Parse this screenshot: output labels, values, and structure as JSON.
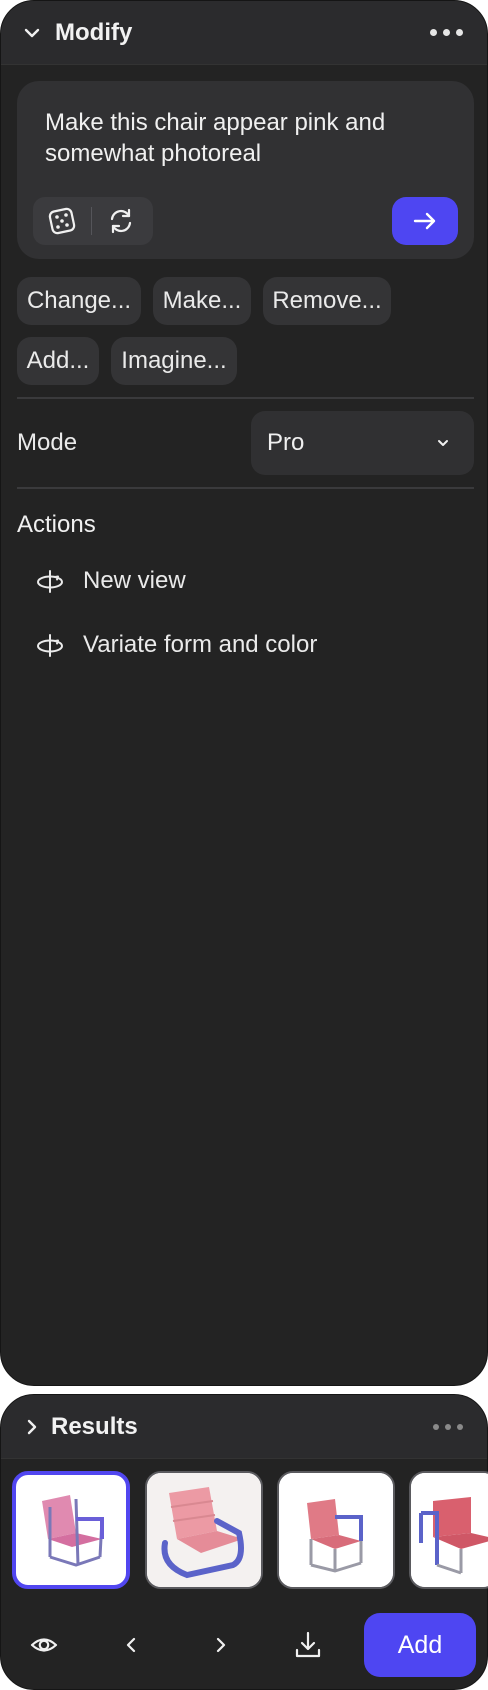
{
  "modify_panel": {
    "title": "Modify",
    "prompt": {
      "text": "Make this chair appear pink and somewhat photoreal"
    },
    "suggestions": [
      "Change...",
      "Make...",
      "Remove...",
      "Add...",
      "Imagine..."
    ],
    "mode": {
      "label": "Mode",
      "value": "Pro"
    },
    "actions": {
      "title": "Actions",
      "items": [
        "New view",
        "Variate form and color"
      ]
    }
  },
  "results_panel": {
    "title": "Results",
    "add_label": "Add",
    "thumbnails": [
      "pink chair with blue frame (selected)",
      "pink padded armchair with blue tubular frame",
      "pink chair with blue and grey frame",
      "pink chair cropped"
    ]
  },
  "colors": {
    "accent": "#4e46f2",
    "panel": "#232323",
    "chip": "#343436",
    "chair_pink": "#e27a8c",
    "chair_frame": "#5b63c9"
  }
}
